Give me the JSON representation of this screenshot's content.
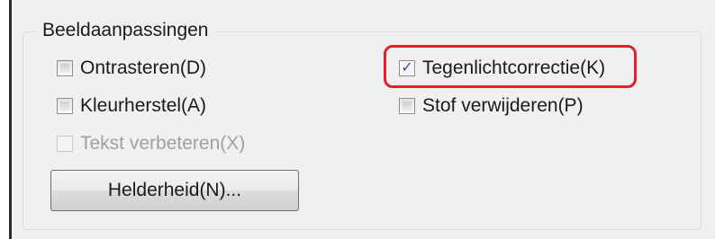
{
  "group": {
    "title": "Beeldaanpassingen"
  },
  "options": {
    "descreening": {
      "label": "Ontrasteren(D)",
      "checked": false,
      "enabled": true
    },
    "color_restoration": {
      "label": "Kleurherstel(A)",
      "checked": false,
      "enabled": true
    },
    "text_enhancement": {
      "label": "Tekst verbeteren(X)",
      "checked": false,
      "enabled": false
    },
    "backlight_correction": {
      "label": "Tegenlichtcorrectie(K)",
      "checked": true,
      "enabled": true
    },
    "dust_removal": {
      "label": "Stof verwijderen(P)",
      "checked": false,
      "enabled": true
    }
  },
  "brightness_button": {
    "label": "Helderheid(N)..."
  },
  "colors": {
    "highlight": "#e0202a",
    "checkmark": "#2f4f9a"
  }
}
